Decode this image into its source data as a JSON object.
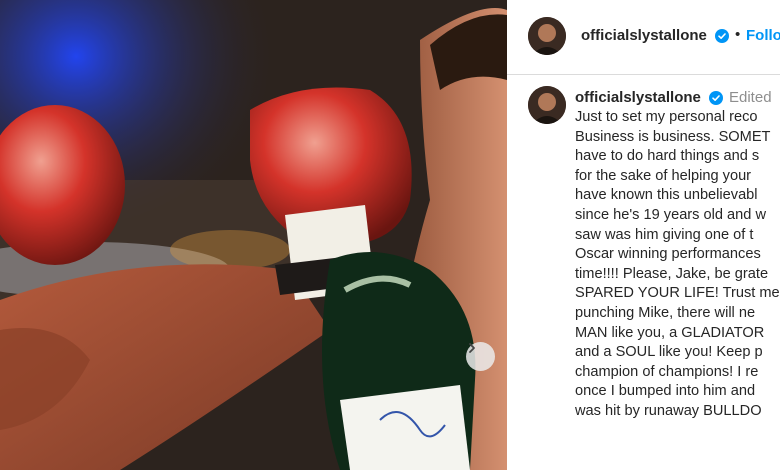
{
  "post": {
    "username": "officialslystallone",
    "follow_label": "Follow",
    "separator": "•"
  },
  "caption": {
    "username": "officialslystallone",
    "edited_label": "Edited",
    "lines": [
      "Just to set my personal reco",
      "Business is business. SOMET",
      "have to do hard things and s",
      "for the sake of helping your",
      "have known this unbelievabl",
      "since he's 19 years old and w",
      "saw was him giving one of t",
      "Oscar winning performances",
      "time!!!! Please, Jake, be grate",
      "SPARED YOUR LIFE! Trust me",
      "punching Mike, there will ne",
      "MAN like you, a GLADIATOR",
      "and a SOUL like you! Keep p",
      "champion of champions! I re",
      "once I bumped into him and",
      "was hit by runaway BULLDO"
    ]
  },
  "colors": {
    "link": "#0095f6",
    "text": "#262626",
    "muted": "#8e8e8e",
    "verified": "#0095f6"
  },
  "icons": {
    "verified": "verified-badge-icon",
    "next": "chevron-right-icon"
  }
}
